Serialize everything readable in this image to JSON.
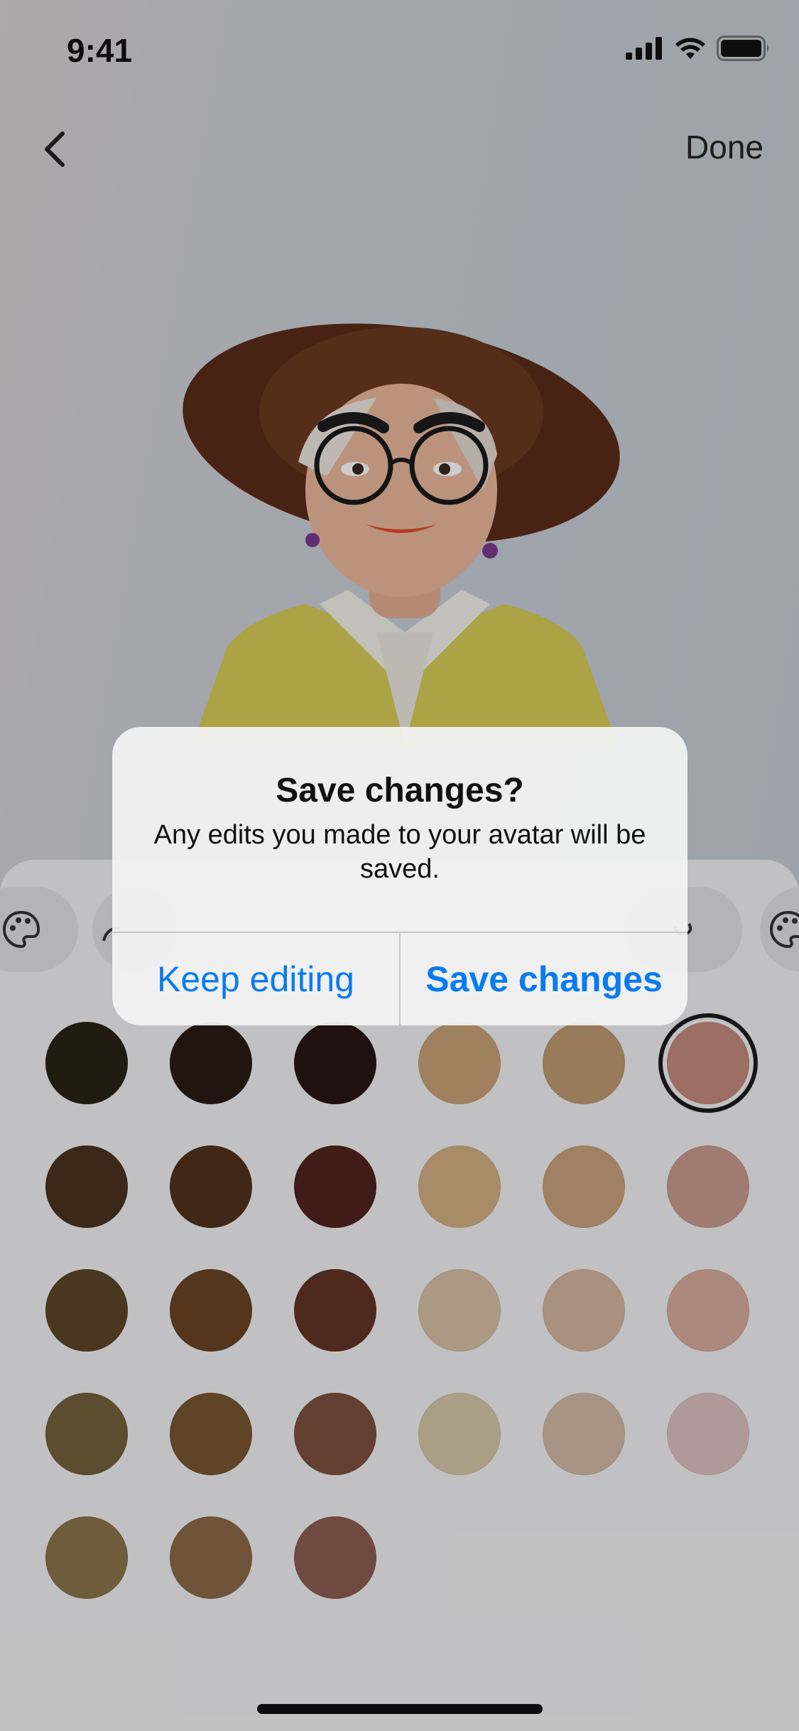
{
  "status_bar": {
    "time": "9:41"
  },
  "nav": {
    "done_label": "Done"
  },
  "alert": {
    "title": "Save changes?",
    "message": "Any edits you made to your avatar will be saved.",
    "secondary_label": "Keep editing",
    "primary_label": "Save changes"
  },
  "colors": {
    "accent": "#0a7bf0",
    "swatches": [
      [
        "#2a2216",
        "#2a1b15",
        "#2a1414",
        "#c8a277",
        "#bf9a72",
        "#c48a7d"
      ],
      [
        "#4b3320",
        "#52321c",
        "#4f231c",
        "#d3b083",
        "#c9a27c",
        "#c99a8f"
      ],
      [
        "#5d4529",
        "#6a4426",
        "#653426",
        "#d8c0a4",
        "#d5b59e",
        "#d7ac9d"
      ],
      [
        "#73603c",
        "#775533",
        "#7d5140",
        "#d5c7a7",
        "#d2b9a6",
        "#dcc1c0"
      ],
      [
        "#8a744a",
        "#8c6a49",
        "#8d5d50"
      ]
    ],
    "selected_swatch": "row1-col6"
  },
  "icons": [
    "cellular-signal-icon",
    "wifi-icon",
    "battery-icon",
    "back-chevron-icon",
    "palette-icon",
    "brush-icon"
  ]
}
